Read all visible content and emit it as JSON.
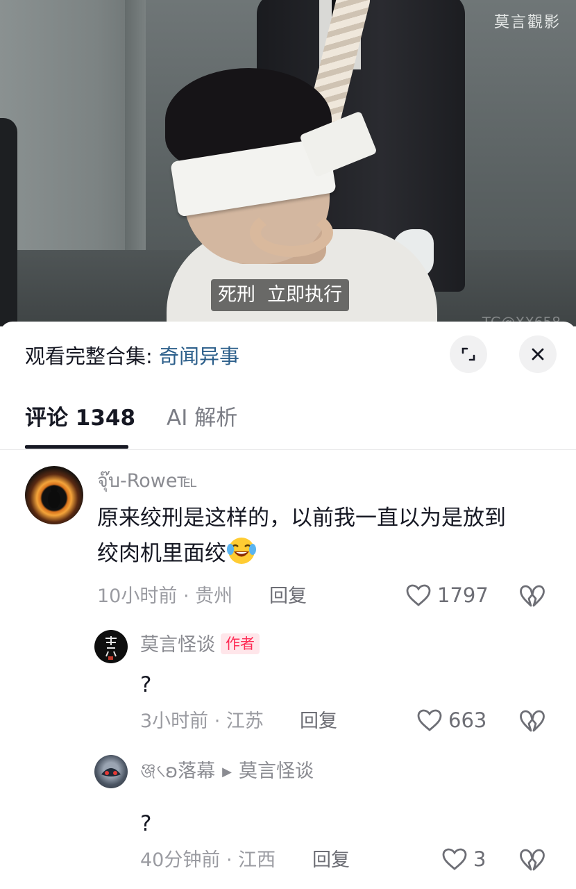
{
  "video": {
    "watermark": "莫言觀影",
    "watermark_tg": "TG@XX658",
    "subtitle": "死刑  立即执行"
  },
  "header": {
    "collection_prefix": "观看完整合集: ",
    "collection_name": "奇闻异事"
  },
  "tabs": {
    "comments_label": "评论 1348",
    "ai_label": "AI 解析"
  },
  "comments": [
    {
      "username": "จุ๊บ-Rowe℡",
      "text_line1": "原来绞刑是这样的，以前我一直以为是放到",
      "text_line2": "绞肉机里面绞",
      "emoji": "laughing-crying-emoji",
      "time_location": "10小时前 · 贵州",
      "reply_label": "回复",
      "likes": "1797"
    },
    {
      "username": "莫言怪谈",
      "badge": "作者",
      "text": "?",
      "time_location": "3小时前 · 江苏",
      "reply_label": "回复",
      "likes": "663"
    },
    {
      "username": "ঞ্জ৻ʚ落幕",
      "reply_to": "莫言怪谈",
      "text": "?",
      "time_location": "40分钟前 · 江西",
      "reply_label": "回复",
      "likes": "3"
    }
  ],
  "colors": {
    "accent_link": "#2b5e8a",
    "author_badge": "#fe2c55",
    "text_primary": "#161823",
    "text_secondary": "#8a8b91"
  }
}
